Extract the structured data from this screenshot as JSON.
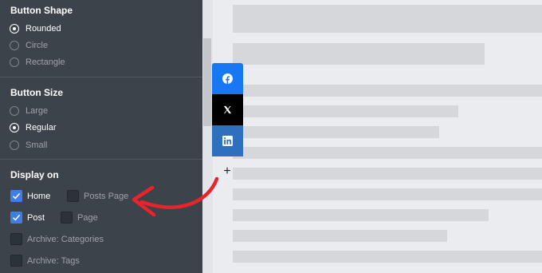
{
  "panel": {
    "button_shape": {
      "heading": "Button Shape",
      "options": [
        {
          "label": "Rounded",
          "selected": true
        },
        {
          "label": "Circle",
          "selected": false
        },
        {
          "label": "Rectangle",
          "selected": false
        }
      ]
    },
    "button_size": {
      "heading": "Button Size",
      "options": [
        {
          "label": "Large",
          "selected": false
        },
        {
          "label": "Regular",
          "selected": true
        },
        {
          "label": "Small",
          "selected": false
        }
      ]
    },
    "display_on": {
      "heading": "Display on",
      "options": [
        {
          "label": "Home",
          "checked": true
        },
        {
          "label": "Posts Page",
          "checked": false
        },
        {
          "label": "Post",
          "checked": true
        },
        {
          "label": "Page",
          "checked": false
        },
        {
          "label": "Archive: Categories",
          "checked": false
        },
        {
          "label": "Archive: Tags",
          "checked": false
        }
      ]
    }
  },
  "preview": {
    "share_buttons": [
      {
        "icon": "facebook-icon",
        "color": "#1877f2"
      },
      {
        "icon": "x-icon",
        "color": "#000000"
      },
      {
        "icon": "linkedin-icon",
        "color": "#2f6fbf"
      }
    ],
    "more_label": "+"
  },
  "colors": {
    "panel_bg": "#3c434a",
    "checkbox_on": "#3e7ee6",
    "arrow": "#e8232a",
    "content_bar": "#d5d7da"
  }
}
